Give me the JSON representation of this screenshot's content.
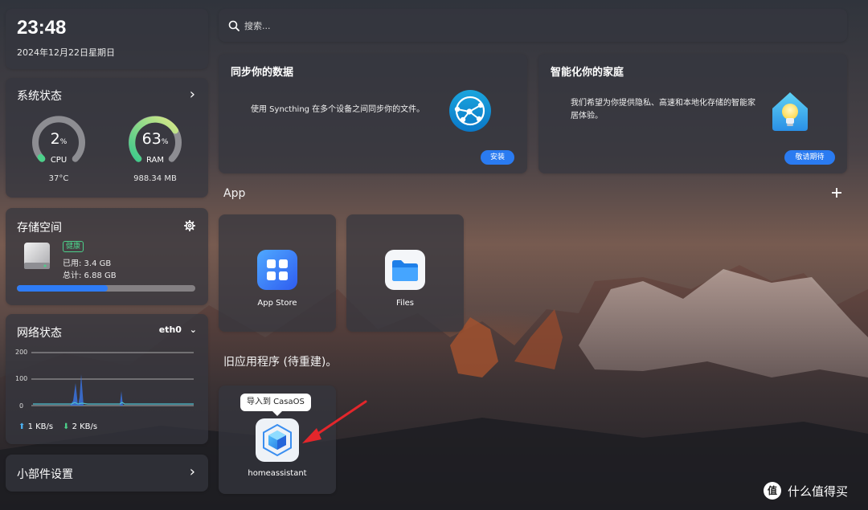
{
  "clock": {
    "time": "23:48",
    "date": "2024年12月22日星期日"
  },
  "system_status": {
    "title": "系统状态",
    "cpu": {
      "value": "2",
      "unit": "%",
      "label": "CPU",
      "sub": "37°C",
      "percent": 2
    },
    "ram": {
      "value": "63",
      "unit": "%",
      "label": "RAM",
      "sub": "988.34 MB",
      "percent": 63
    }
  },
  "storage": {
    "title": "存储空间",
    "badge": "健康",
    "used": "已用: 3.4 GB",
    "total": "总计: 6.88 GB",
    "fill_fraction": 0.51
  },
  "network": {
    "title": "网络状态",
    "interface": "eth0",
    "y_ticks": [
      "200",
      "100",
      "0"
    ],
    "upload": "1 KB/s",
    "download": "2 KB/s"
  },
  "widget_settings": {
    "label": "小部件设置"
  },
  "search": {
    "placeholder": "搜索..."
  },
  "cards": {
    "sync": {
      "title": "同步你的数据",
      "desc": "使用 Syncthing 在多个设备之间同步你的文件。",
      "button": "安装"
    },
    "home": {
      "title": "智能化你的家庭",
      "desc": "我们希望为你提供隐私、高速和本地化存储的智能家居体验。",
      "button": "敬请期待"
    }
  },
  "apps": {
    "section_title": "App",
    "items": [
      {
        "name": "App Store"
      },
      {
        "name": "Files"
      }
    ]
  },
  "legacy": {
    "section_title": "旧应用程序 (待重建)。",
    "tooltip": "导入到 CasaOS",
    "app_name": "homeassistant"
  },
  "watermark": {
    "text": "什么值得买",
    "icon_text": "值"
  },
  "colors": {
    "accent": "#2a7bf1",
    "cpu_gauge": "#4cd08a",
    "ram_gauge": "#6ee08e",
    "healthy": "#4cd08a",
    "chart_line": "#4cc0d0",
    "chart_spike": "#3a6fd6"
  }
}
